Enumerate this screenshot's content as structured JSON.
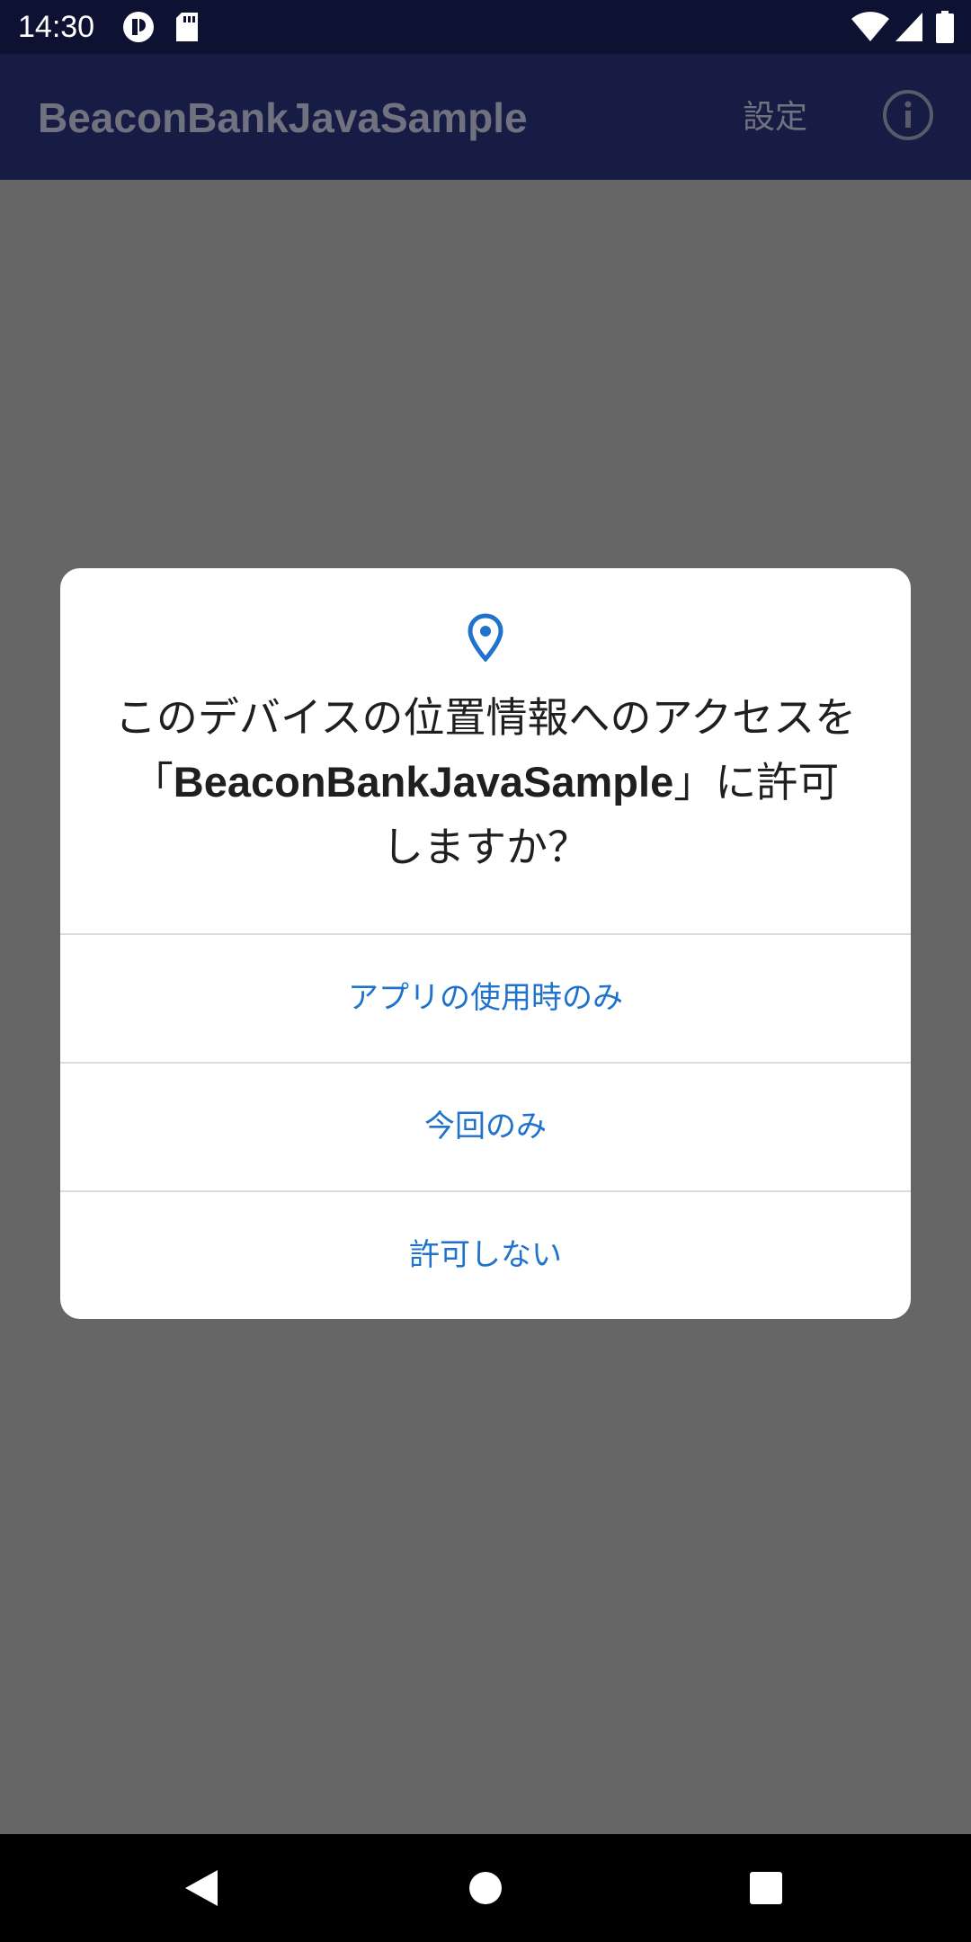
{
  "status_bar": {
    "time": "14:30",
    "left_icons": [
      "app-notification-icon",
      "sd-card-icon"
    ],
    "right_icons": [
      "wifi-icon",
      "cell-signal-icon",
      "battery-icon"
    ]
  },
  "app_bar": {
    "title": "BeaconBankJavaSample",
    "settings_label": "設定",
    "info_icon": "info-icon"
  },
  "dialog": {
    "icon": "location-pin-icon",
    "message_before": "このデバイスの位置情報へのアクセスを「",
    "app_name": "BeaconBankJavaSample",
    "message_after": "」に許可しますか？",
    "options": [
      {
        "label": "アプリの使用時のみ"
      },
      {
        "label": "今回のみ"
      },
      {
        "label": "許可しない"
      }
    ]
  },
  "nav_bar": {
    "buttons": [
      "back-icon",
      "home-icon",
      "recents-icon"
    ]
  },
  "colors": {
    "status_bar_bg": "#0d1233",
    "app_bar_bg": "#171c45",
    "scrim_bg": "#666666",
    "dialog_bg": "#ffffff",
    "accent": "#1f73cc",
    "nav_bar_bg": "#000000"
  }
}
